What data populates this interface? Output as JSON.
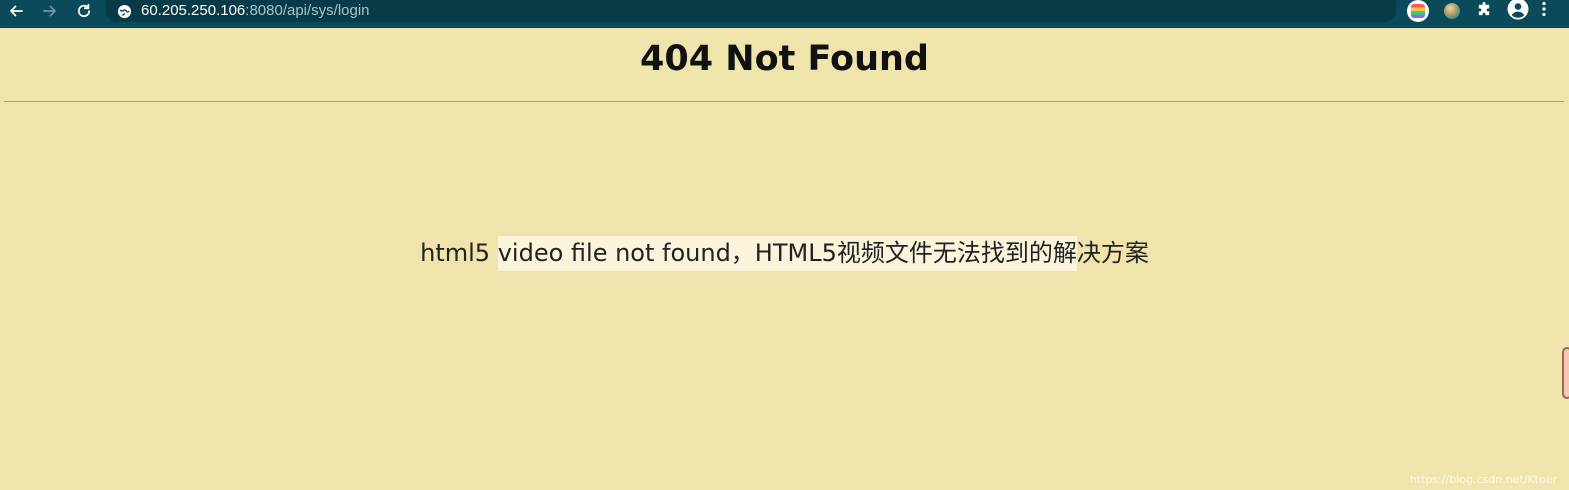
{
  "browser": {
    "url_host": "60.205.250.106",
    "url_rest": ":8080/api/sys/login",
    "icons": {
      "back": "arrow-left-icon",
      "forward": "arrow-right-icon",
      "reload": "reload-icon",
      "site": "site-info-icon",
      "extension_1": "colorful-extension-icon",
      "extension_2": "orb-extension-icon",
      "extensions": "puzzle-icon",
      "profile": "profile-icon",
      "menu": "kebab-menu-icon"
    },
    "colors": {
      "toolbar": "#0b4a5b",
      "omnibox": "#083a47"
    }
  },
  "page": {
    "title": "404 Not Found",
    "text_part1": "html5 ",
    "text_highlight": "video file not found，HTML5视频文件无法找到的解",
    "text_part2": "决方案",
    "watermark": "https://blog.csdn.net/Ktoer",
    "colors": {
      "background": "#f0e4ad",
      "highlight": "#faf4da"
    }
  }
}
